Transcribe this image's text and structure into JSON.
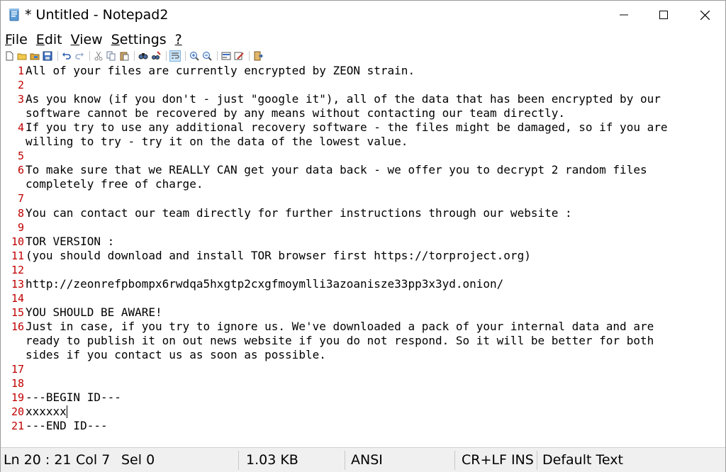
{
  "window": {
    "title": "* Untitled - Notepad2"
  },
  "menu": [
    {
      "mnemonic": "F",
      "rest": "ile"
    },
    {
      "mnemonic": "E",
      "rest": "dit"
    },
    {
      "mnemonic": "V",
      "rest": "iew"
    },
    {
      "mnemonic": "S",
      "rest": "ettings"
    },
    {
      "mnemonic": "?",
      "rest": ""
    }
  ],
  "toolbar": {
    "icons": [
      "new-file-icon",
      "open-file-icon",
      "browse-icon",
      "save-icon",
      "undo-icon",
      "redo-icon",
      "cut-icon",
      "copy-icon",
      "paste-icon",
      "find-icon",
      "replace-icon",
      "word-wrap-icon",
      "zoom-in-icon",
      "zoom-out-icon",
      "scheme-icon",
      "customize-schemes-icon",
      "exit-icon"
    ]
  },
  "editor": {
    "lines": [
      {
        "num": "1",
        "text": "All of your files are currently encrypted by ZEON strain."
      },
      {
        "num": "2",
        "text": ""
      },
      {
        "num": "3",
        "text": "As you know (if you don't - just \"google it\"), all of the data that has been encrypted by our"
      },
      {
        "num": "",
        "text": "software cannot be recovered by any means without contacting our team directly."
      },
      {
        "num": "4",
        "text": "If you try to use any additional recovery software - the files might be damaged, so if you are"
      },
      {
        "num": "",
        "text": "willing to try - try it on the data of the lowest value."
      },
      {
        "num": "5",
        "text": ""
      },
      {
        "num": "6",
        "text": "To make sure that we REALLY CAN get your data back - we offer you to decrypt 2 random files"
      },
      {
        "num": "",
        "text": "completely free of charge."
      },
      {
        "num": "7",
        "text": ""
      },
      {
        "num": "8",
        "text": "You can contact our team directly for further instructions through our website :"
      },
      {
        "num": "9",
        "text": ""
      },
      {
        "num": "10",
        "text": "TOR VERSION :"
      },
      {
        "num": "11",
        "text": "(you should download and install TOR browser first https://torproject.org)"
      },
      {
        "num": "12",
        "text": ""
      },
      {
        "num": "13",
        "text": "http://zeonrefpbompx6rwdqa5hxgtp2cxgfmoymlli3azoanisze33pp3x3yd.onion/"
      },
      {
        "num": "14",
        "text": ""
      },
      {
        "num": "15",
        "text": "YOU SHOULD BE AWARE!"
      },
      {
        "num": "16",
        "text": "Just in case, if you try to ignore us. We've downloaded a pack of your internal data and are"
      },
      {
        "num": "",
        "text": "ready to publish it on out news website if you do not respond. So it will be better for both"
      },
      {
        "num": "",
        "text": "sides if you contact us as soon as possible."
      },
      {
        "num": "17",
        "text": ""
      },
      {
        "num": "18",
        "text": ""
      },
      {
        "num": "19",
        "text": "---BEGIN ID---"
      },
      {
        "num": "20",
        "text": "xxxxxx"
      },
      {
        "num": "21",
        "text": "---END ID---"
      }
    ]
  },
  "statusbar": {
    "position": "Ln 20 : 21",
    "column": "Col 7",
    "selection": "Sel 0",
    "size": "1.03 KB",
    "encoding": "ANSI",
    "line_endings": "CR+LF INS",
    "scheme": "Default Text"
  }
}
